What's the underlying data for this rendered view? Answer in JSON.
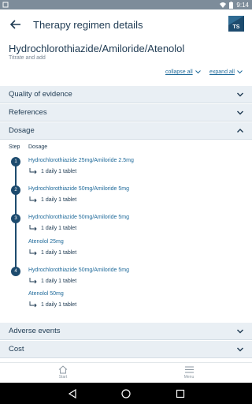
{
  "status_bar": {
    "time": "9:14"
  },
  "app_bar": {
    "title": "Therapy regimen details",
    "logo_text": "TS"
  },
  "regimen": {
    "title": "Hydrochlorothiazide/Amiloride/Atenolol",
    "subtitle": "Titrate and add"
  },
  "controls": {
    "collapse_all": "collapse all",
    "expand_all": "expand all"
  },
  "sections": {
    "quality": "Quality of evidence",
    "references": "References",
    "dosage": "Dosage",
    "adverse": "Adverse events",
    "cost": "Cost"
  },
  "dosage_table": {
    "col_step": "Step",
    "col_dosage": "Dosage",
    "steps": [
      {
        "number": "1",
        "entries": [
          {
            "drug": "Hydrochlorothiazide 25mg/Amiloride 2.5mg",
            "dose": "1 daily 1 tablet"
          }
        ]
      },
      {
        "number": "2",
        "entries": [
          {
            "drug": "Hydrochlorothiazide 50mg/Amiloride 5mg",
            "dose": "1 daily 1 tablet"
          }
        ]
      },
      {
        "number": "3",
        "entries": [
          {
            "drug": "Hydrochlorothiazide 50mg/Amiloride 5mg",
            "dose": "1 daily 1 tablet"
          },
          {
            "drug": "Atenolol 25mg",
            "dose": "1 daily 1 tablet"
          }
        ]
      },
      {
        "number": "4",
        "entries": [
          {
            "drug": "Hydrochlorothiazide 50mg/Amiloride 5mg",
            "dose": "1 daily 1 tablet"
          },
          {
            "drug": "Atenolol 50mg",
            "dose": "1 daily 1 tablet"
          }
        ]
      }
    ]
  },
  "bottom_nav": {
    "start": "Start",
    "menu": "Menu"
  },
  "icons": {
    "back": "arrow-left-icon",
    "chevron_down": "chevron-down-icon",
    "chevron_up": "chevron-up-icon",
    "home": "home-icon",
    "menu": "hamburger-menu-icon",
    "dose_connector": "dose-connector-icon"
  },
  "colors": {
    "accent": "#1f6a9a",
    "brand": "#1d4b6e",
    "section_bg": "#e9eff4",
    "status_bar": "#7d8c9a"
  }
}
